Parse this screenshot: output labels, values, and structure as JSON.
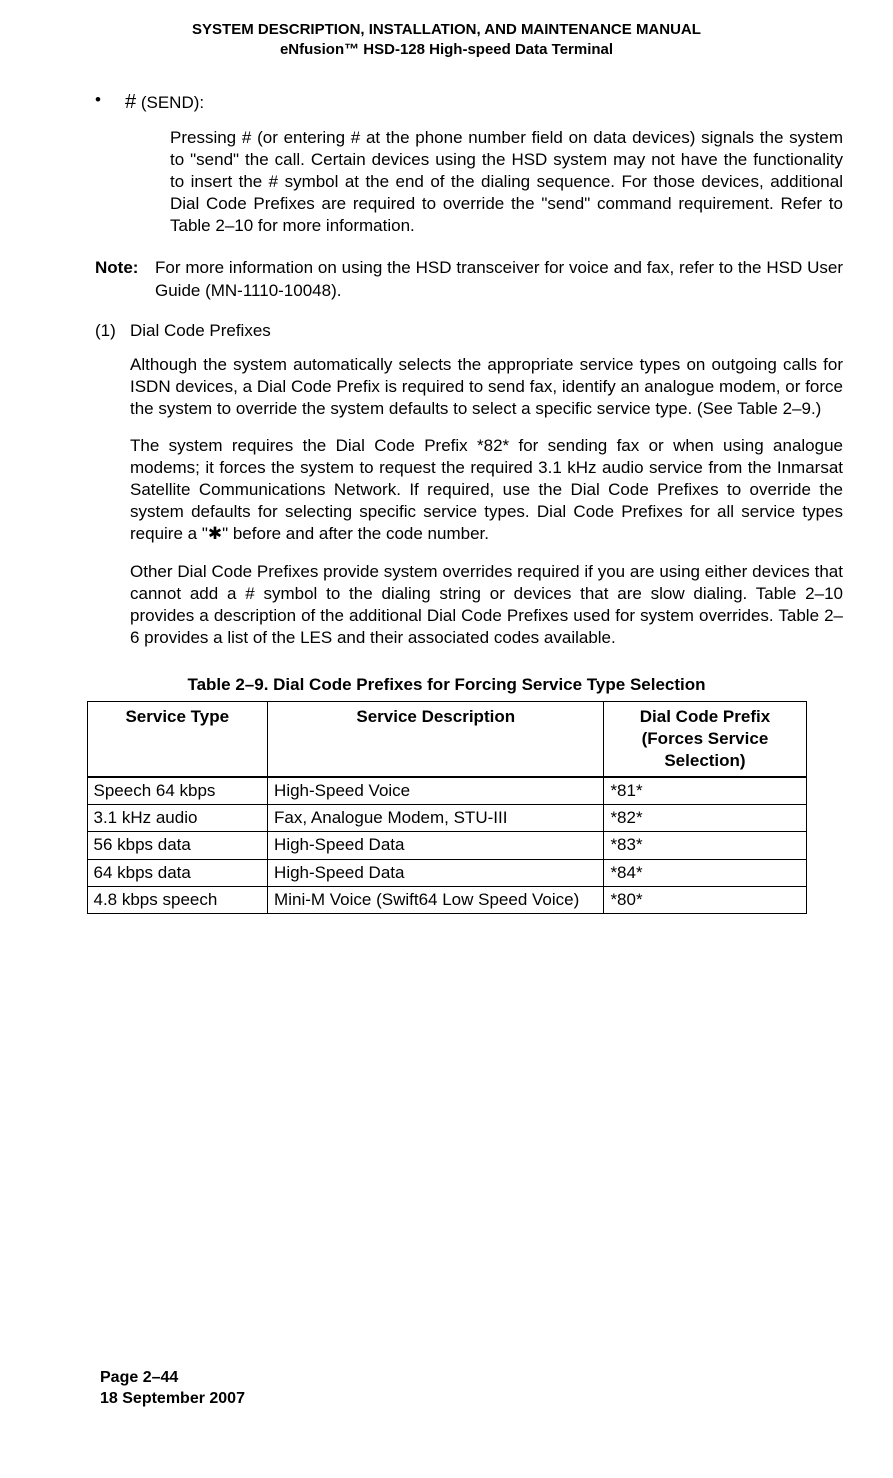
{
  "header": {
    "line1": "SYSTEM DESCRIPTION, INSTALLATION, AND MAINTENANCE MANUAL",
    "line2": "eNfusion™ HSD-128 High-speed Data Terminal"
  },
  "bullet": {
    "dot": "•",
    "hash": "#",
    "send": " (SEND):",
    "para": "Pressing # (or entering # at the phone number field on data devices) signals the system to \"send\" the call. Certain devices using the HSD system may not have the functionality to insert the # symbol at the end of the dialing sequence. For those devices, additional Dial Code Prefixes are required to override the \"send\" command requirement. Refer to Table 2–10 for more information."
  },
  "note": {
    "label": "Note:",
    "text": "For more information on using the HSD transceiver for voice and fax, refer to the HSD User Guide (MN-1110-10048)."
  },
  "item1": {
    "num": "(1)",
    "title": "Dial Code Prefixes",
    "p1": "Although the system automatically selects the appropriate service types on outgoing calls for ISDN devices, a Dial Code Prefix is required to send fax, identify an analogue modem, or force the system to override the system defaults to select a specific service type. (See Table 2–9.)",
    "p2": "The system requires the Dial Code Prefix *82* for sending fax or when using analogue modems; it forces the system to request the required 3.1 kHz audio service from the Inmarsat Satellite Communications Network. If required, use the Dial Code Prefixes to override the system defaults for selecting specific service types. Dial Code Prefixes for all service types require a \"✱\" before and after the code number.",
    "p3": "Other Dial Code Prefixes provide system overrides required if you are using either devices that cannot add a # symbol to the dialing string or devices that are slow dialing. Table 2–10 provides a description of the additional Dial Code Prefixes used for system overrides. Table 2–6 provides a list of the LES and their associated codes available."
  },
  "table": {
    "caption": "Table 2–9. Dial Code Prefixes for Forcing Service Type Selection",
    "headers": {
      "h1": "Service Type",
      "h2": "Service Description",
      "h3": "Dial Code Prefix (Forces Service Selection)"
    },
    "rows": [
      {
        "c1": "Speech 64 kbps",
        "c2": "High-Speed Voice",
        "c3": "*81*"
      },
      {
        "c1": "3.1 kHz audio",
        "c2": "Fax, Analogue Modem, STU-III",
        "c3": "*82*"
      },
      {
        "c1": "56 kbps data",
        "c2": "High-Speed Data",
        "c3": "*83*"
      },
      {
        "c1": "64 kbps data",
        "c2": "High-Speed Data",
        "c3": "*84*"
      },
      {
        "c1": "4.8 kbps speech",
        "c2": "Mini-M Voice (Swift64 Low Speed Voice)",
        "c3": "*80*"
      }
    ]
  },
  "footer": {
    "page": "Page 2–44",
    "date": "18 September 2007"
  }
}
